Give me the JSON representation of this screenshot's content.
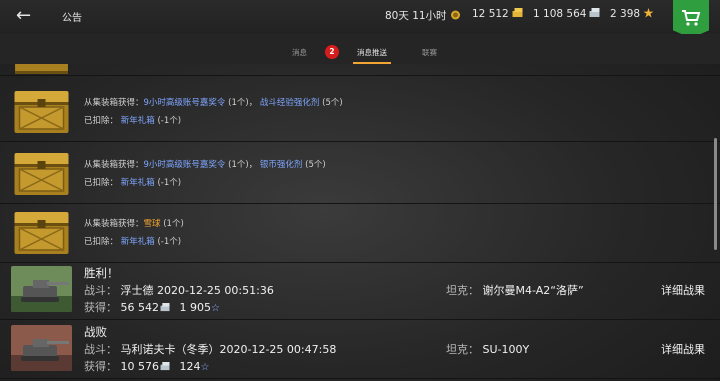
{
  "header": {
    "back_label": "←",
    "title": "公告",
    "premium_time": "80天 11小时",
    "gold": "12 512",
    "credits": "1 108 564",
    "free_xp": "2 398"
  },
  "tabs": [
    {
      "label": "消息"
    },
    {
      "label": "消息推送",
      "active": true
    },
    {
      "label": "联赛"
    }
  ],
  "badge_count": "2",
  "rewards": [
    {
      "from_label": "从集装箱获得：",
      "items": [
        {
          "name": "9小时高级账号嘉奖令",
          "qty": "(1个)",
          "sep": "，",
          "color": "link"
        },
        {
          "name": "战斗经验强化剂",
          "qty": "(5个)",
          "sep": "",
          "color": "link"
        }
      ],
      "deducted_label": "已扣除：",
      "deducted_item": "新年礼箱",
      "deducted_qty": "(-1个)"
    },
    {
      "from_label": "从集装箱获得：",
      "items": [
        {
          "name": "9小时高级账号嘉奖令",
          "qty": "(1个)",
          "sep": "，",
          "color": "link"
        },
        {
          "name": "银币强化剂",
          "qty": "(5个)",
          "sep": "",
          "color": "link"
        }
      ],
      "deducted_label": "已扣除：",
      "deducted_item": "新年礼箱",
      "deducted_qty": "(-1个)"
    },
    {
      "from_label": "从集装箱获得：",
      "items": [
        {
          "name": "雪球",
          "qty": "(1个)",
          "sep": "",
          "color": "gold"
        }
      ],
      "deducted_label": "已扣除：",
      "deducted_item": "新年礼箱",
      "deducted_qty": "(-1个)"
    }
  ],
  "battles": [
    {
      "result": "胜利！",
      "battle_label": "战斗：",
      "map_datetime": "浮士德 2020-12-25 00:51:36",
      "earned_label": "获得：",
      "credits": "56 542",
      "xp": "1 905",
      "tank_label": "坦克：",
      "tank": "谢尔曼M4-A2“洛萨”",
      "details": "详细战果"
    },
    {
      "result": "战败",
      "battle_label": "战斗：",
      "map_datetime": "马利诺夫卡（冬季）2020-12-25 00:47:58",
      "earned_label": "获得：",
      "credits": "10 576",
      "xp": "124",
      "tank_label": "坦克：",
      "tank": "SU-100Y",
      "details": "详细战果"
    }
  ],
  "colors": {
    "accent": "#f2a530",
    "link": "#7fa6ff",
    "shop": "#2f9e3f",
    "badge": "#d51d1d"
  }
}
